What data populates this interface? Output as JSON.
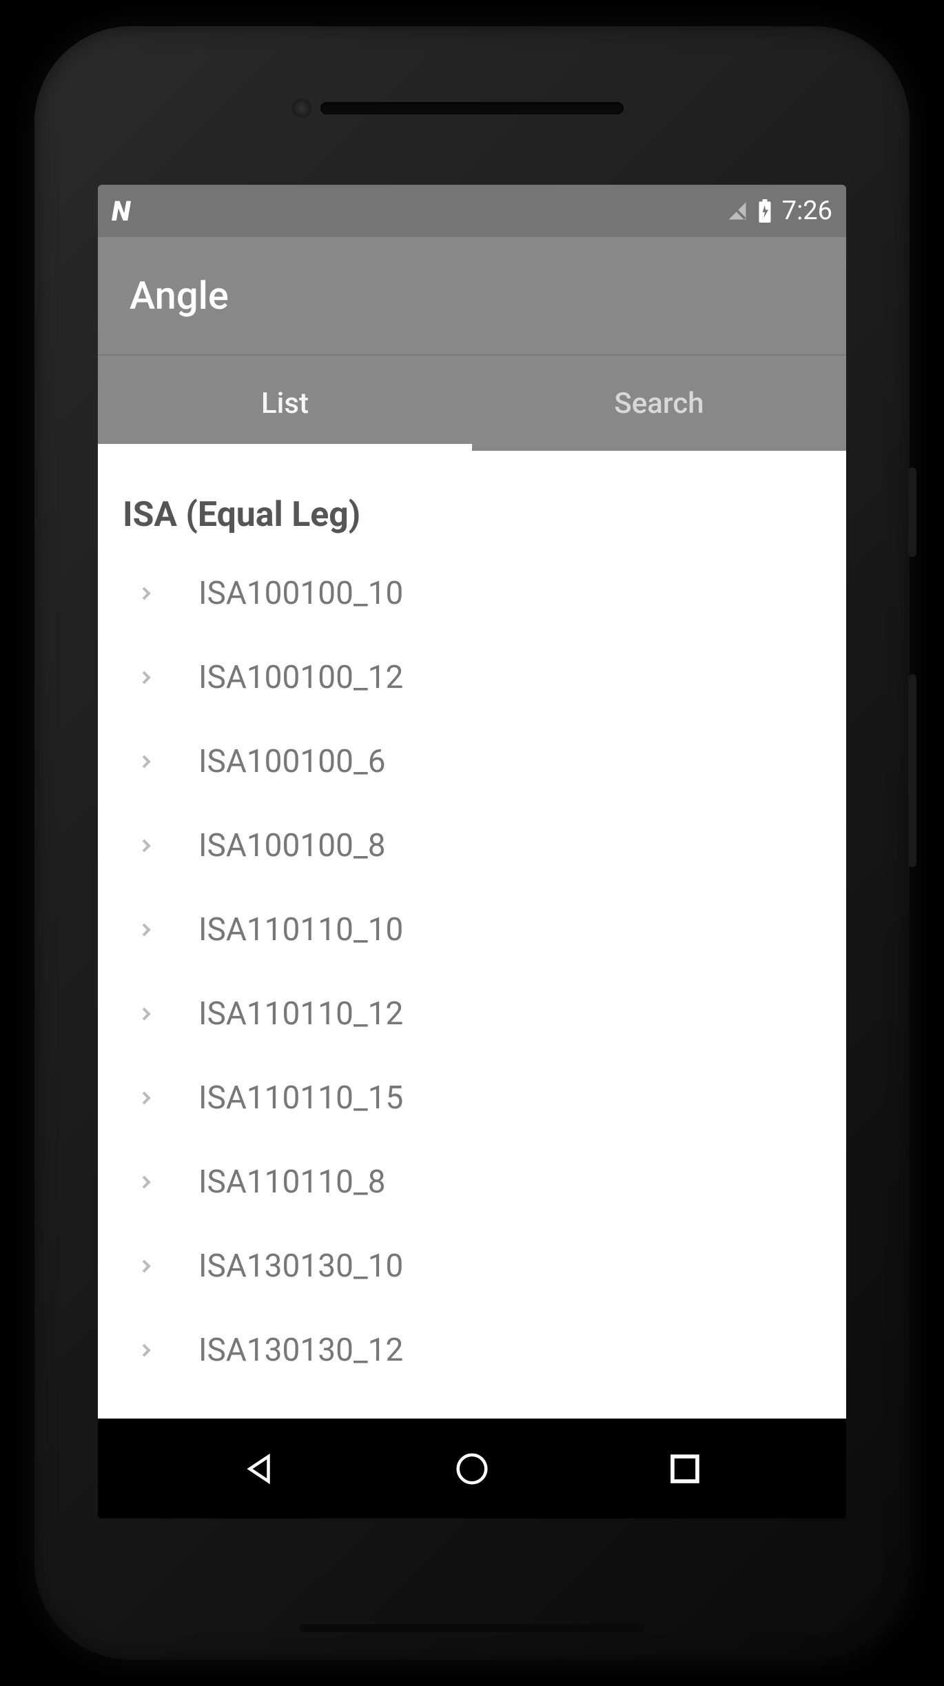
{
  "status_bar": {
    "time": "7:26"
  },
  "header": {
    "title": "Angle"
  },
  "tabs": [
    {
      "label": "List",
      "active": true
    },
    {
      "label": "Search",
      "active": false
    }
  ],
  "section": {
    "title": "ISA  (Equal Leg)"
  },
  "items": [
    {
      "label": "ISA100100_10"
    },
    {
      "label": "ISA100100_12"
    },
    {
      "label": "ISA100100_6"
    },
    {
      "label": "ISA100100_8"
    },
    {
      "label": "ISA110110_10"
    },
    {
      "label": "ISA110110_12"
    },
    {
      "label": "ISA110110_15"
    },
    {
      "label": "ISA110110_8"
    },
    {
      "label": "ISA130130_10"
    },
    {
      "label": "ISA130130_12"
    }
  ]
}
